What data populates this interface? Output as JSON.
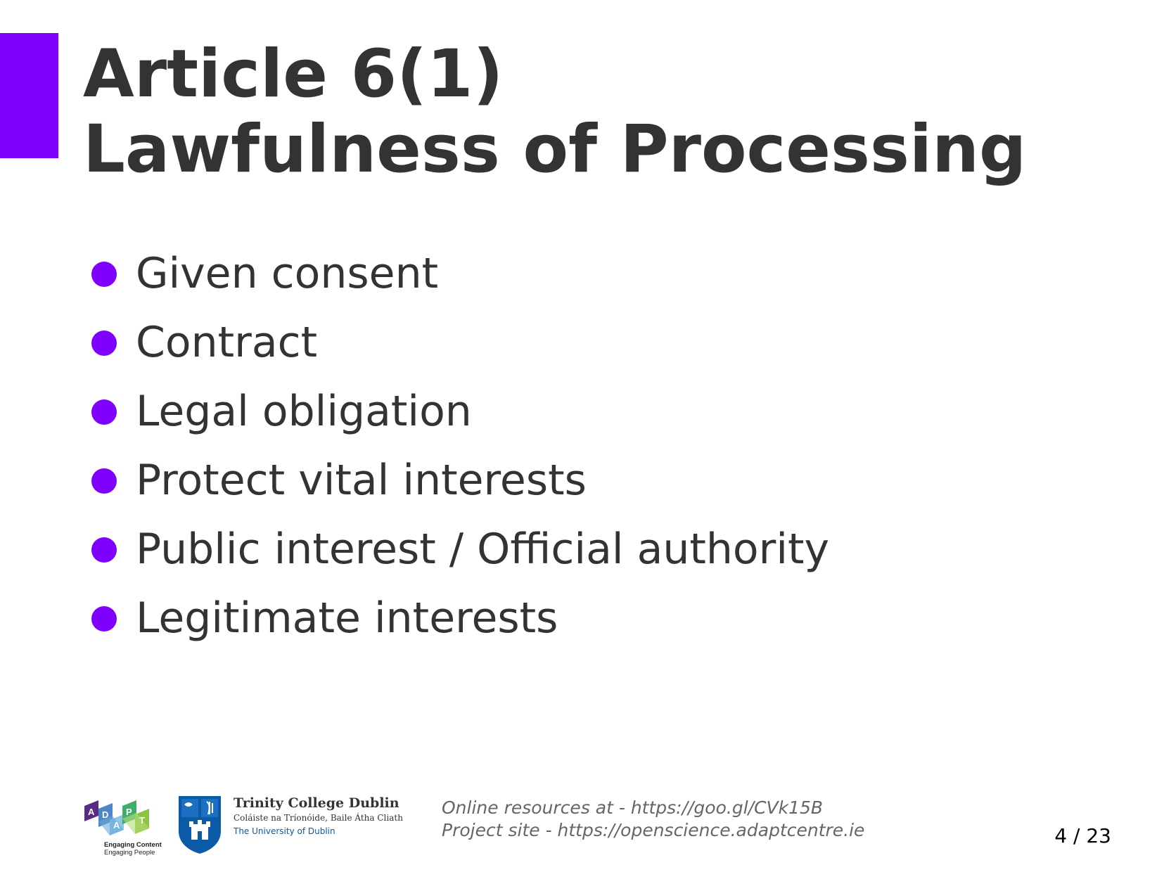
{
  "slide": {
    "title_line1": "Article 6(1)",
    "title_line2": "Lawfulness of Processing",
    "bullets": [
      "Given consent",
      "Contract",
      "Legal obligation",
      "Protect vital interests",
      "Public interest / Official authority",
      "Legitimate interests"
    ]
  },
  "footer": {
    "adapt_letters": [
      "A",
      "D",
      "A",
      "P",
      "T"
    ],
    "adapt_tagline_1": "Engaging Content",
    "adapt_tagline_2": "Engaging People",
    "tcd_name": "Trinity College Dublin",
    "tcd_irish": "Coláiste na Tríonóide, Baile Átha Cliath",
    "tcd_university": "The University of Dublin",
    "online_resources": "Online resources at - https://goo.gl/CVk15B",
    "project_site": "Project site - https://openscience.adaptcentre.ie",
    "page_number": "4 / 23"
  },
  "colors": {
    "accent": "#8000ff",
    "text": "#333333",
    "footer_text": "#666666"
  }
}
